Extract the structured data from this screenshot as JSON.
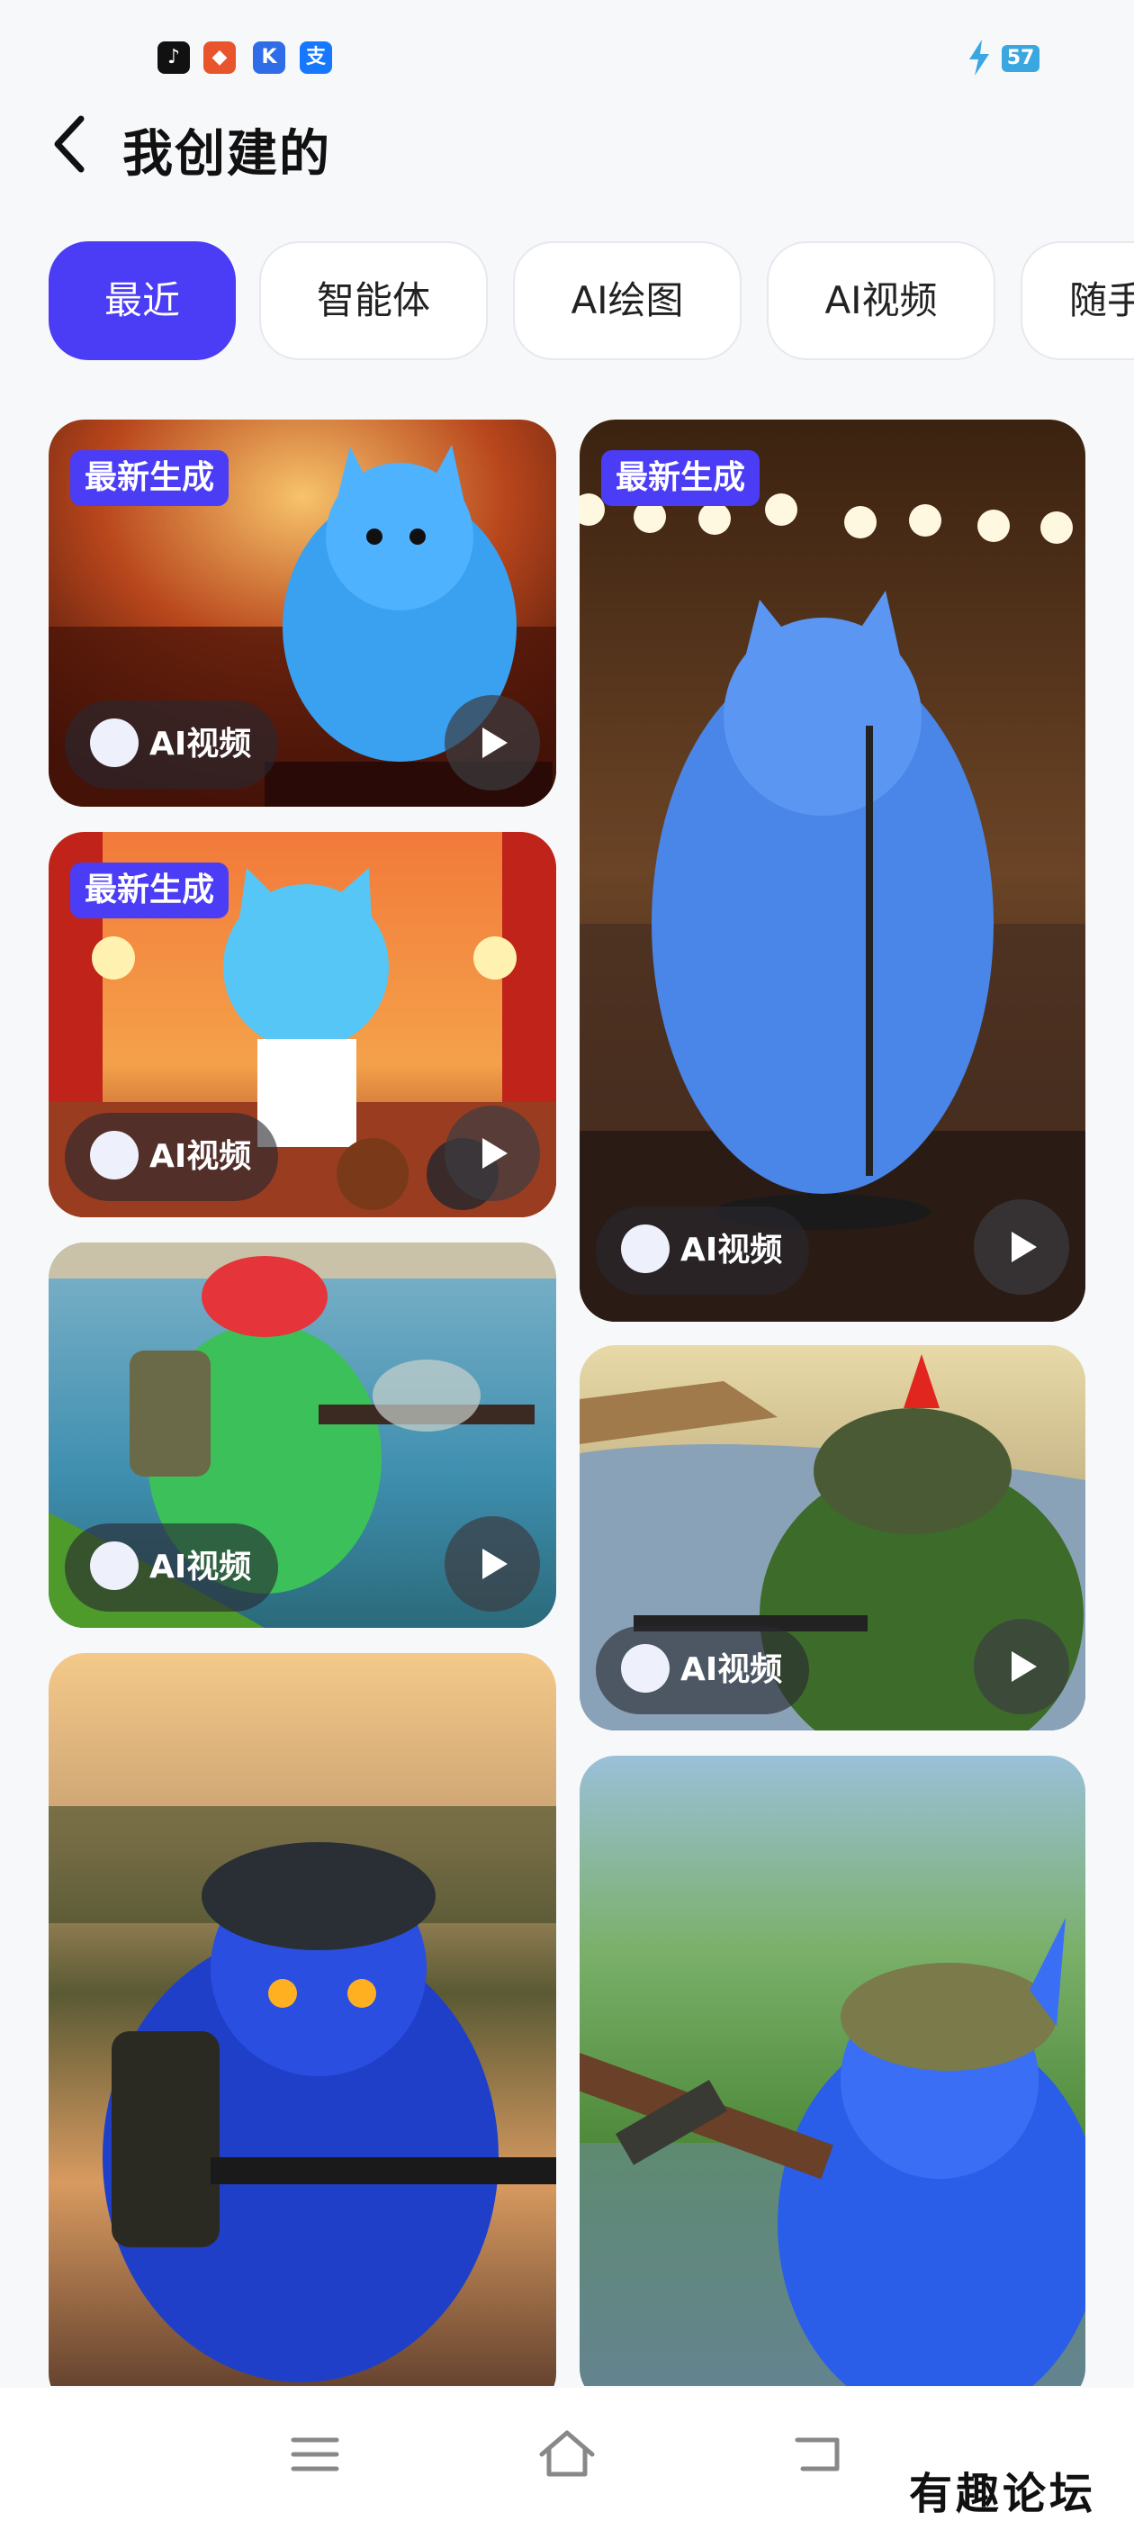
{
  "status_bar": {
    "apps": [
      {
        "icon": "tiktok-icon",
        "glyph": "♪"
      },
      {
        "icon": "food-app-icon",
        "glyph": "◆"
      },
      {
        "icon": "k-app-icon",
        "glyph": "K"
      },
      {
        "icon": "alipay-icon",
        "glyph": "支"
      }
    ],
    "battery_level": "57",
    "charging": true
  },
  "header": {
    "title": "我创建的"
  },
  "tabs": [
    {
      "label": "最近",
      "active": true
    },
    {
      "label": "智能体",
      "active": false
    },
    {
      "label": "AI绘图",
      "active": false
    },
    {
      "label": "AI视频",
      "active": false
    },
    {
      "label": "随手",
      "active": false
    }
  ],
  "cards": [
    {
      "badge": "最新生成",
      "type_label": "AI视频",
      "scene": "blue cat singing on concert stage"
    },
    {
      "badge": "最新生成",
      "type_label": "AI视频",
      "scene": "blue cat standing at microphone under stage lights"
    },
    {
      "badge": "最新生成",
      "type_label": "AI视频",
      "scene": "cartoon blue cat singing on theater stage"
    },
    {
      "badge": "",
      "type_label": "AI视频",
      "scene": "green cat soldier with rifle by river"
    },
    {
      "badge": "",
      "type_label": "AI视频",
      "scene": "green cat soldier in camouflage helmet"
    },
    {
      "badge": "",
      "type_label": "",
      "scene": "blue cat soldier with helmet at sunset river"
    },
    {
      "badge": "",
      "type_label": "",
      "scene": "blue cat soldier aiming rifle in reeds"
    }
  ],
  "watermark": "有趣论坛",
  "colors": {
    "accent": "#4b3cf5",
    "background": "#f7f8fa"
  }
}
